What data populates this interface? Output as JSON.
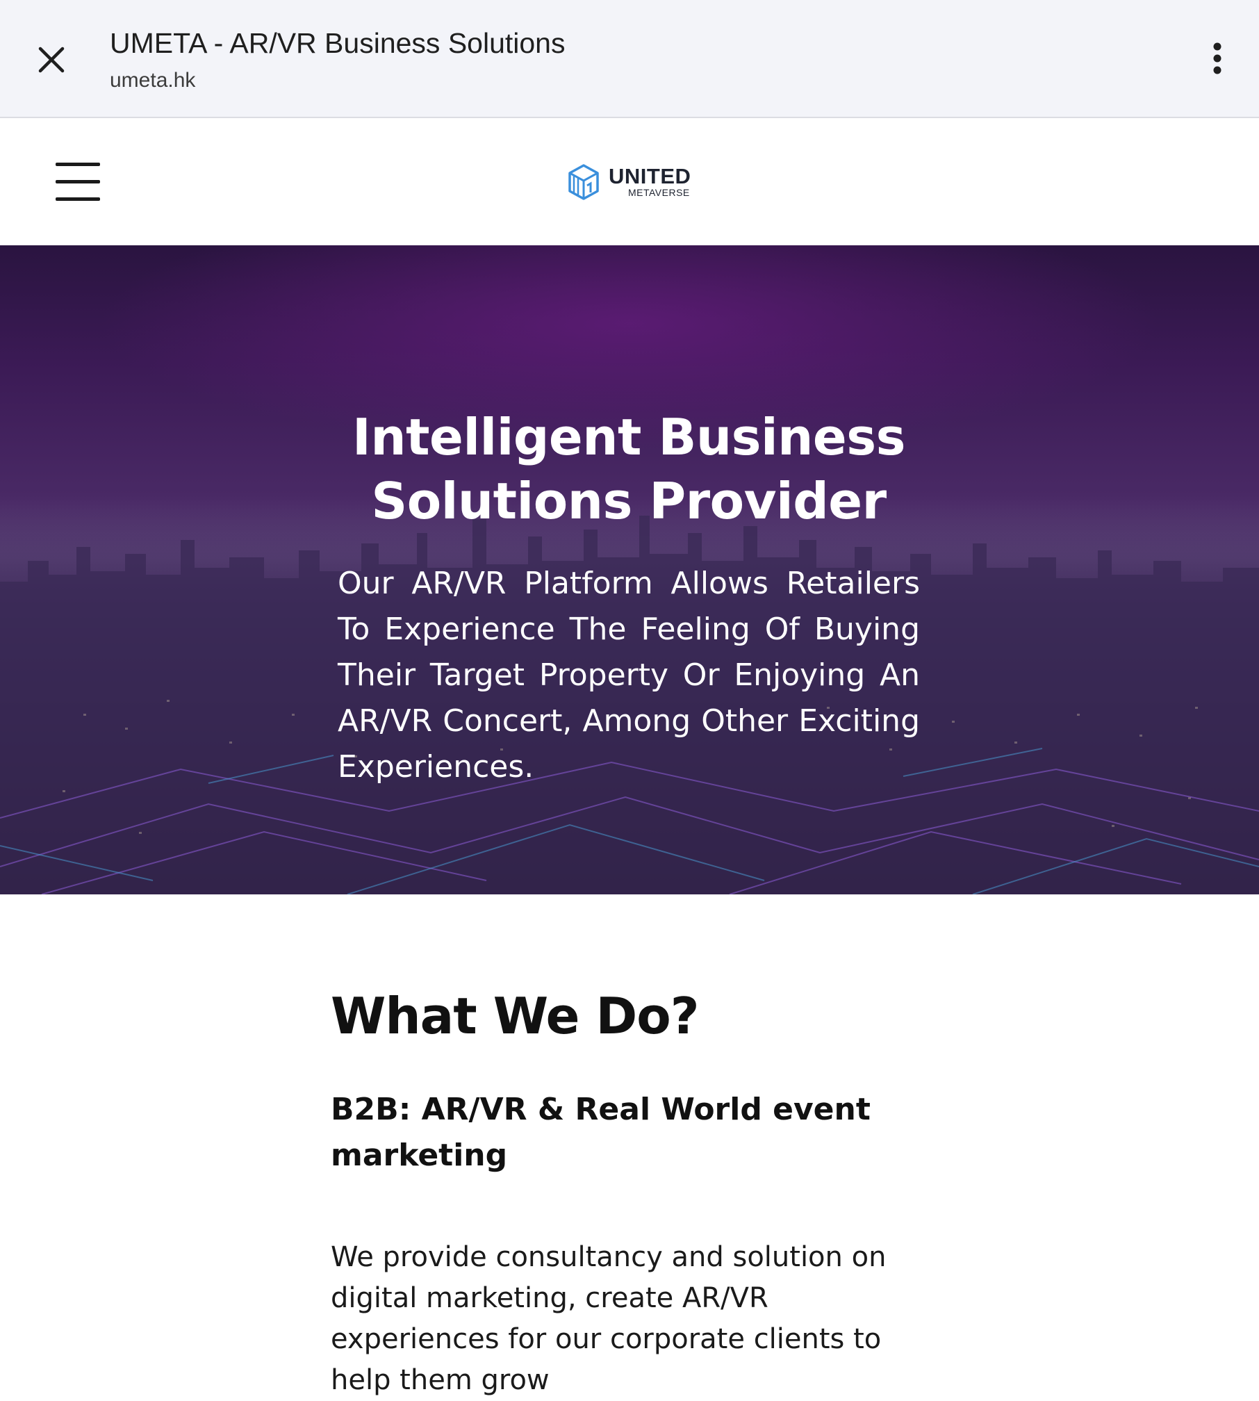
{
  "browser": {
    "page_title": "UMETA - AR/VR Business Solutions",
    "url": "umeta.hk"
  },
  "header": {
    "brand_name": "UNITED",
    "brand_sub": "METAVERSE",
    "brand_color": "#3a8fdc"
  },
  "hero": {
    "title": "Intelligent Business Solutions Provider",
    "subtitle": "Our AR/VR Platform Allows Retailers To Experience The Feeling Of Buying Their Target Property Or Enjoying An AR/VR Concert, Among Other Exciting Experiences."
  },
  "section": {
    "heading": "What We Do?",
    "subheading": "B2B: AR/VR & Real World event marketing",
    "body": "We provide consultancy and solution on digital marketing, create AR/VR experiences for our corporate clients to help them grow"
  },
  "colors": {
    "topbar_bg": "#f3f4f9",
    "hero_purple": "#3b1a55",
    "text_dark": "#111111"
  }
}
